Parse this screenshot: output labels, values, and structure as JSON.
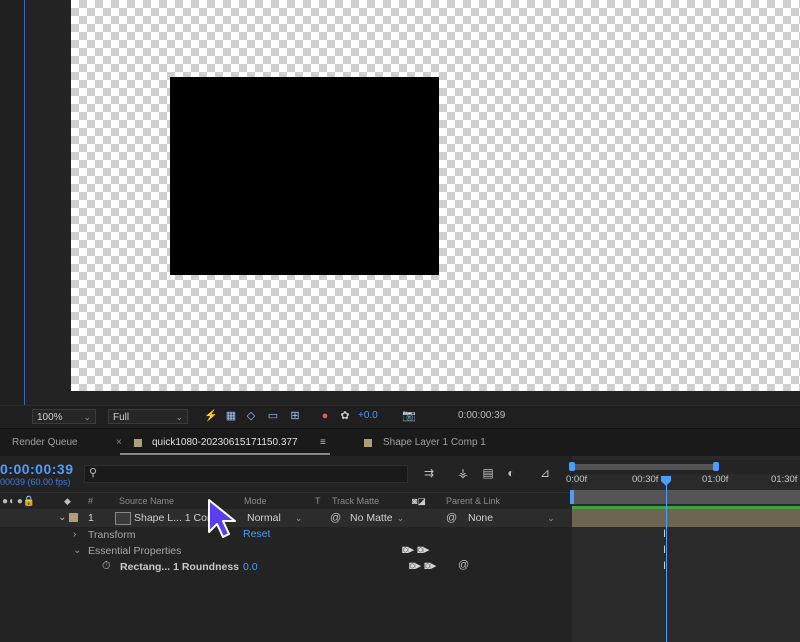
{
  "viewer": {
    "zoom": "100%",
    "resolution": "Full",
    "exposure": "+0.0",
    "timecode": "0:00:00:39"
  },
  "tabs": [
    {
      "label": "Render Queue",
      "active": false
    },
    {
      "label": "quick1080-2023061517111 50.377",
      "active": true
    },
    {
      "label": "Shape Layer 1 Comp 1",
      "active": false
    }
  ],
  "tab_labels": {
    "render_queue": "Render Queue",
    "comp": "quick1080-20230615171115 0.377",
    "shape_comp": "Shape Layer 1 Comp 1"
  },
  "timeline": {
    "timecode": "0:00:00:39",
    "frames": "00039 (60.00 fps)",
    "search_placeholder": "",
    "columns": {
      "num": "#",
      "source_name": "Source Name",
      "mode": "Mode",
      "t": "T",
      "track_matte": "Track Matte",
      "parent_link": "Parent & Link"
    },
    "layer": {
      "index": "1",
      "name": "Shape L... 1 Comp 1",
      "mode": "Normal",
      "matte": "No Matte",
      "parent": "None"
    },
    "properties": {
      "transform": "Transform",
      "transform_action": "Reset",
      "essential": "Essential Properties",
      "roundness_label": "Rectang... 1 Roundness",
      "roundness_value": "0.0"
    },
    "ruler": {
      "labels": [
        "0:00f",
        "00:30f",
        "01:00f",
        "01:30f"
      ]
    }
  },
  "colors": {
    "accent": "#4d9cff",
    "layer_label": "#b09d7a",
    "layer_bar": "#6b6552",
    "work_bar": "#3ea53e"
  },
  "icons": [
    "flowchart-icon",
    "snapshot-icon",
    "color-channels-icon",
    "toggle-transparency-icon",
    "region-of-interest-icon",
    "grid-icon",
    "mask-visibility-icon",
    "search-icon",
    "comp-mini-flowchart-icon",
    "draft-3d-icon",
    "frame-blending-icon",
    "motion-blur-icon",
    "graph-editor-icon",
    "stopwatch-icon",
    "pick-whip-icon"
  ]
}
